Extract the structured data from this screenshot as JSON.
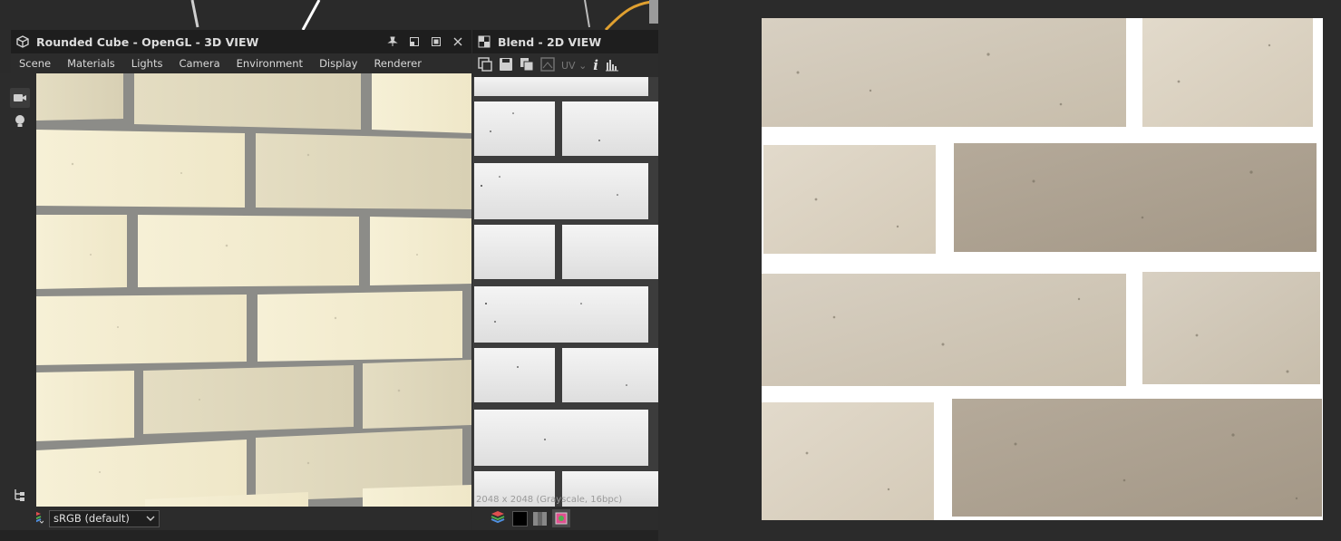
{
  "view3d": {
    "title": "Rounded Cube - OpenGL - 3D VIEW",
    "menu": [
      "Scene",
      "Materials",
      "Lights",
      "Camera",
      "Environment",
      "Display",
      "Renderer"
    ],
    "colorspace": "sRGB (default)"
  },
  "view2d": {
    "title": "Blend - 2D VIEW",
    "uv_label": "UV",
    "info_label": "i",
    "image_info": "2048 x 2048 (Grayscale, 16bpc)"
  },
  "icons": {
    "pin": "pin-icon",
    "restore": "restore-icon",
    "maximize": "maximize-icon",
    "close": "close-icon",
    "camera": "camera-icon",
    "light": "lightbulb-icon",
    "tree": "tree-icon",
    "layers": "layers-icon",
    "save": "save-icon",
    "copy": "copy-icon",
    "histogram": "histogram-icon"
  },
  "colors": {
    "panel": "#252525",
    "titlebar": "#1e1e1e",
    "accent_orange": "#e0a030",
    "brick_light": "#f5efd6",
    "brick_tan": "#ddd6bd",
    "mortar": "#8c8c88"
  }
}
